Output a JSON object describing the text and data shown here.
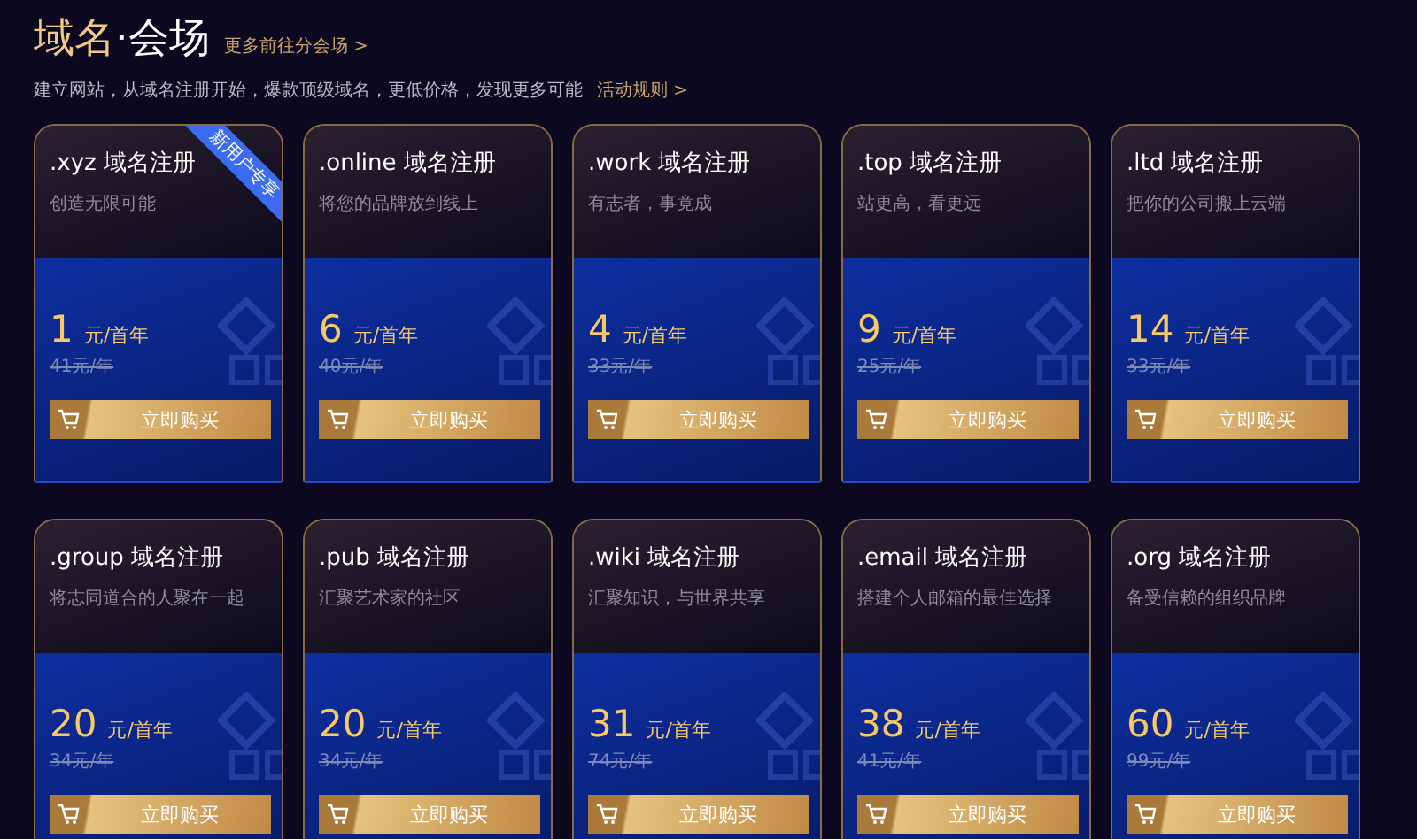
{
  "header": {
    "title_highlight": "域名",
    "title_rest": "·会场",
    "more_link": "更多前往分会场 >",
    "subtitle": "建立网站，从域名注册开始，爆款顶级域名，更低价格，发现更多可能",
    "rules_link": "活动规则 >"
  },
  "cards": [
    {
      "title": ".xyz 域名注册",
      "desc": "创造无限可能",
      "price": "1",
      "unit": "元/首年",
      "old_price": "41元/年",
      "button": "立即购买",
      "badge": "新用户专享"
    },
    {
      "title": ".online 域名注册",
      "desc": "将您的品牌放到线上",
      "price": "6",
      "unit": "元/首年",
      "old_price": "40元/年",
      "button": "立即购买"
    },
    {
      "title": ".work 域名注册",
      "desc": "有志者，事竟成",
      "price": "4",
      "unit": "元/首年",
      "old_price": "33元/年",
      "button": "立即购买"
    },
    {
      "title": ".top 域名注册",
      "desc": "站更高，看更远",
      "price": "9",
      "unit": "元/首年",
      "old_price": "25元/年",
      "button": "立即购买"
    },
    {
      "title": ".ltd 域名注册",
      "desc": "把你的公司搬上云端",
      "price": "14",
      "unit": "元/首年",
      "old_price": "33元/年",
      "button": "立即购买"
    },
    {
      "title": ".group 域名注册",
      "desc": "将志同道合的人聚在一起",
      "price": "20",
      "unit": "元/首年",
      "old_price": "34元/年",
      "button": "立即购买"
    },
    {
      "title": ".pub 域名注册",
      "desc": "汇聚艺术家的社区",
      "price": "20",
      "unit": "元/首年",
      "old_price": "34元/年",
      "button": "立即购买"
    },
    {
      "title": ".wiki 域名注册",
      "desc": "汇聚知识，与世界共享",
      "price": "31",
      "unit": "元/首年",
      "old_price": "74元/年",
      "button": "立即购买"
    },
    {
      "title": ".email 域名注册",
      "desc": "搭建个人邮箱的最佳选择",
      "price": "38",
      "unit": "元/首年",
      "old_price": "41元/年",
      "button": "立即购买"
    },
    {
      "title": ".org 域名注册",
      "desc": "备受信赖的组织品牌",
      "price": "60",
      "unit": "元/首年",
      "old_price": "99元/年",
      "button": "立即购买"
    }
  ]
}
